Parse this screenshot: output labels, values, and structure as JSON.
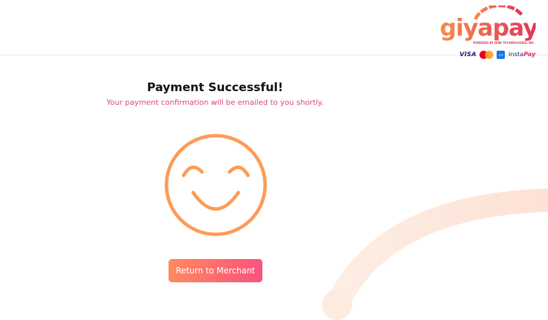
{
  "brand": {
    "name": "giyapay",
    "tagline": "POWERED BY NINE TECHNOLOGIES, INC.",
    "colors": {
      "gradient_start": "#f78c4b",
      "gradient_end": "#e0345e"
    }
  },
  "payment_methods": {
    "visa": "VISA",
    "mastercard_icon": "mastercard-icon",
    "wallet_icon": "wallet-icon",
    "instapay_prefix": "insta",
    "instapay_suffix": "Pay"
  },
  "main": {
    "title": "Payment Successful!",
    "subtitle": "Your payment confirmation will be emailed to you shortly.",
    "illustration_icon": "smiley-face-icon",
    "return_button_label": "Return to Merchant"
  },
  "colors": {
    "accent": "#f8527e",
    "smiley": "#ff9a56",
    "subtitle": "#e0457b"
  }
}
